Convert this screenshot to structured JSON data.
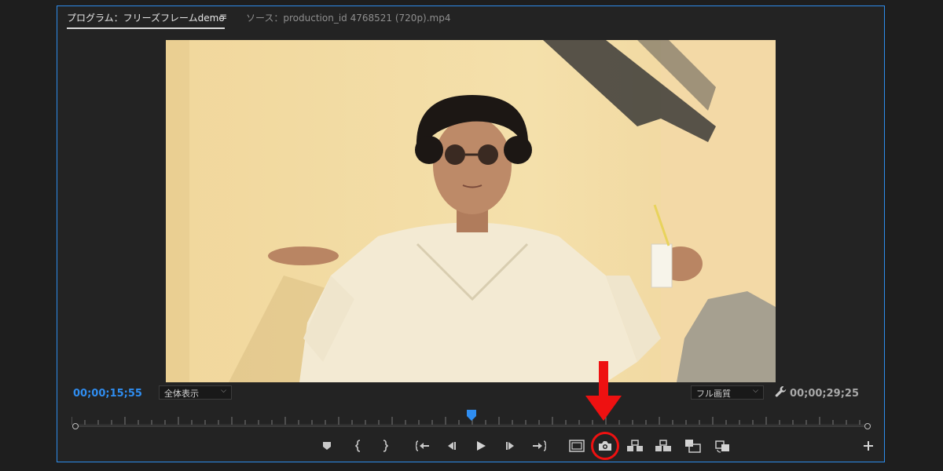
{
  "tabs": {
    "program_label": "プログラム：フリーズフレームdemo",
    "menu_glyph": "≡",
    "source_label": "ソース：production_id 4768521 (720p).mp4"
  },
  "timecodes": {
    "current": "00;00;15;55",
    "duration": "00;00;29;25"
  },
  "zoom_select": {
    "value": "全体表示"
  },
  "quality_select": {
    "value": "フル画質"
  },
  "playhead_position": 0.5,
  "transport_buttons": [
    {
      "name": "add-marker",
      "icon": "marker-icon"
    },
    {
      "name": "mark-in",
      "icon": "mark-in-icon"
    },
    {
      "name": "mark-out",
      "icon": "mark-out-icon"
    },
    {
      "name": "go-to-in",
      "icon": "go-to-in-icon"
    },
    {
      "name": "step-back",
      "icon": "step-back-icon"
    },
    {
      "name": "play",
      "icon": "play-icon"
    },
    {
      "name": "step-forward",
      "icon": "step-forward-icon"
    },
    {
      "name": "go-to-out",
      "icon": "go-to-out-icon"
    },
    {
      "name": "safe-margins",
      "icon": "safe-margins-icon"
    },
    {
      "name": "export-frame",
      "icon": "camera-icon"
    },
    {
      "name": "lift",
      "icon": "lift-icon"
    },
    {
      "name": "extract",
      "icon": "extract-icon"
    },
    {
      "name": "insert",
      "icon": "insert-icon"
    },
    {
      "name": "overwrite",
      "icon": "overwrite-icon"
    }
  ],
  "colors": {
    "accent": "#2d8ceb",
    "timecode_current": "#2f8df0",
    "annotation_red": "#ee1111"
  }
}
